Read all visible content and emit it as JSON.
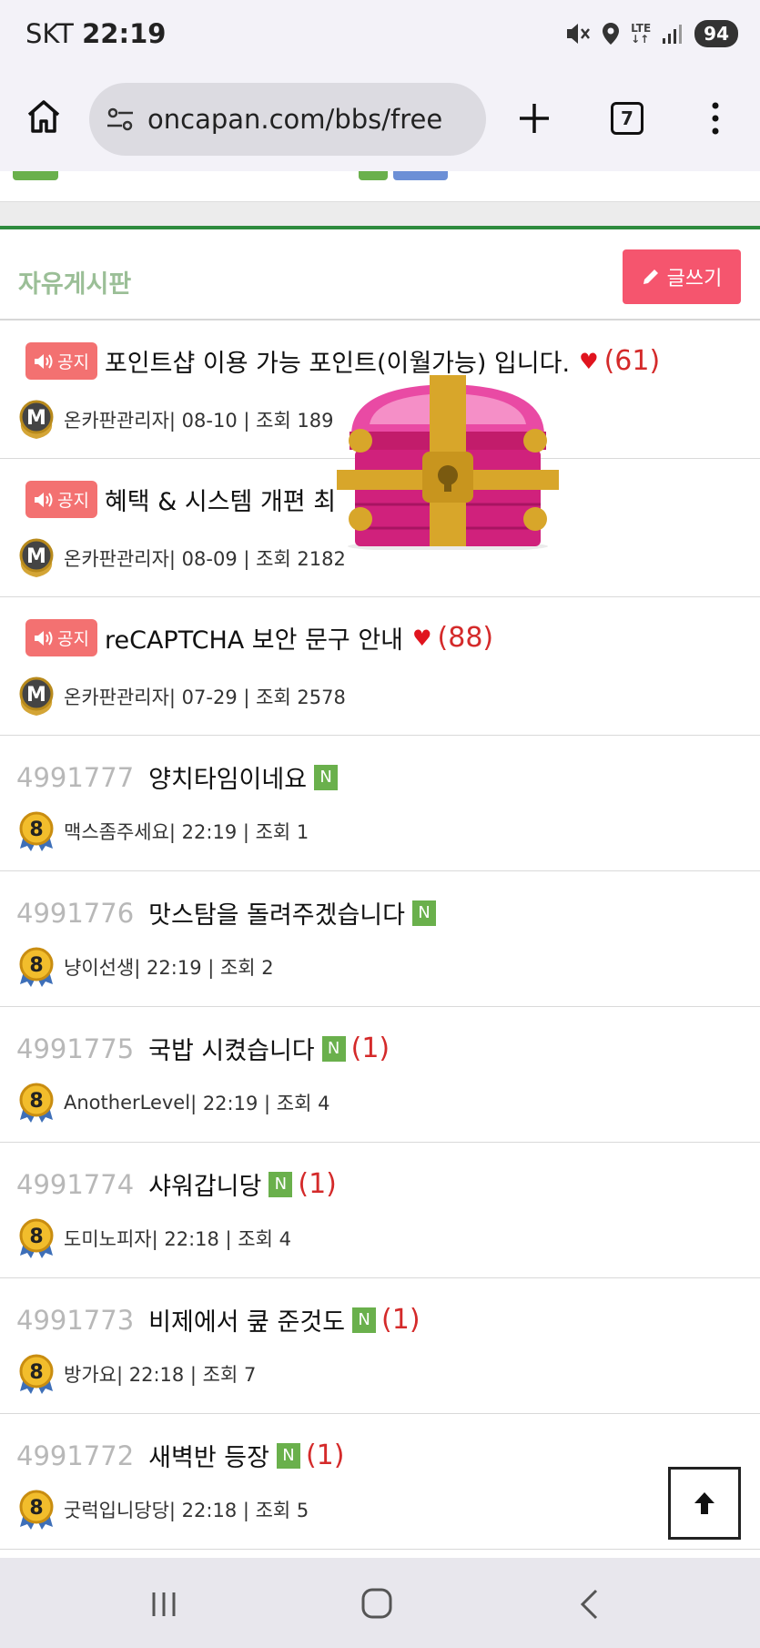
{
  "status_bar": {
    "carrier": "SKT",
    "time": "22:19",
    "network": "LTE",
    "battery": "94"
  },
  "browser": {
    "url": "oncapan.com/bbs/free",
    "tab_count": "7"
  },
  "board": {
    "title": "자유게시판",
    "write_label": "글쓰기"
  },
  "notice_label": "공지",
  "notices": [
    {
      "title": "포인트샵 이용 가능 포인트(이월가능) 입니다.",
      "heart": true,
      "comments": "(61)",
      "author": "온카판관리자",
      "meta": " | 08-10 | 조회 189"
    },
    {
      "title": "혜택 & 시스템 개편 최",
      "heart": false,
      "comments": "",
      "author": "온카판관리자",
      "meta": " | 08-09 | 조회 2182"
    },
    {
      "title": "reCAPTCHA 보안 문구 안내",
      "heart": true,
      "comments": "(88)",
      "author": "온카판관리자",
      "meta": " | 07-29 | 조회 2578"
    }
  ],
  "posts": [
    {
      "num": "4991777",
      "title": "양치타임이네요",
      "new": "N",
      "comments": "",
      "author": "맥스좀주세요",
      "meta": " | 22:19 | 조회 1"
    },
    {
      "num": "4991776",
      "title": "맛스탐을 돌려주겠습니다",
      "new": "N",
      "comments": "",
      "author": "냥이선생",
      "meta": " | 22:19 | 조회 2"
    },
    {
      "num": "4991775",
      "title": "국밥 시켰습니다",
      "new": "N",
      "comments": "(1)",
      "author": "AnotherLevel",
      "meta": " | 22:19 | 조회 4"
    },
    {
      "num": "4991774",
      "title": "샤워갑니당",
      "new": "N",
      "comments": "(1)",
      "author": "도미노피자",
      "meta": " | 22:18 | 조회 4"
    },
    {
      "num": "4991773",
      "title": "비제에서 쿺 준것도",
      "new": "N",
      "comments": "(1)",
      "author": "방가요",
      "meta": " | 22:18 | 조회 7"
    },
    {
      "num": "4991772",
      "title": "새벽반 등장",
      "new": "N",
      "comments": "(1)",
      "author": "굿럭입니당당",
      "meta": " | 22:18 | 조회 5"
    }
  ],
  "level_badge": "8",
  "admin_badge": "M",
  "colors": {
    "accent_green": "#2e8b3e",
    "write_button": "#f5556e",
    "notice_badge": "#f37171",
    "new_badge": "#6ab04c",
    "comment_red": "#d42a2a"
  }
}
